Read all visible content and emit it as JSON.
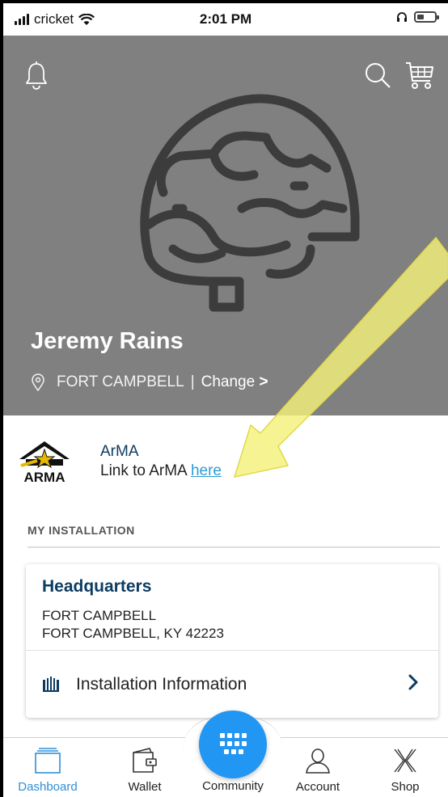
{
  "status_bar": {
    "carrier": "cricket",
    "time": "2:01 PM"
  },
  "hero": {
    "profile_name": "Jeremy Rains",
    "installation": "FORT CAMPBELL",
    "separator": "|",
    "change_label": "Change",
    "change_chevron": ">",
    "icons": [
      "bell-icon",
      "search-icon",
      "cart-icon",
      "helmet-icon",
      "location-pin-icon"
    ],
    "background_color": "#808080"
  },
  "arma": {
    "logo_text": "ARMA",
    "title": "ArMA",
    "link_prefix": "Link to ArMA",
    "link_text": "here"
  },
  "my_installation": {
    "header": "MY INSTALLATION",
    "card": {
      "title": "Headquarters",
      "line1": "FORT CAMPBELL",
      "line2": "FORT CAMPBELL, KY 42223",
      "info_label": "Installation Information",
      "info_chevron": ">"
    }
  },
  "bottom_nav": {
    "items": [
      {
        "label": "Dashboard",
        "active": true,
        "icon": "dashboard-icon"
      },
      {
        "label": "Wallet",
        "active": false,
        "icon": "wallet-icon"
      },
      {
        "label": "Community",
        "active": false,
        "icon": "grid-icon"
      },
      {
        "label": "Account",
        "active": false,
        "icon": "account-icon"
      },
      {
        "label": "Shop",
        "active": false,
        "icon": "shop-icon"
      }
    ],
    "accent_color": "#2196f3"
  },
  "annotation": {
    "type": "yellow-arrow",
    "color": "#f4f27a"
  }
}
